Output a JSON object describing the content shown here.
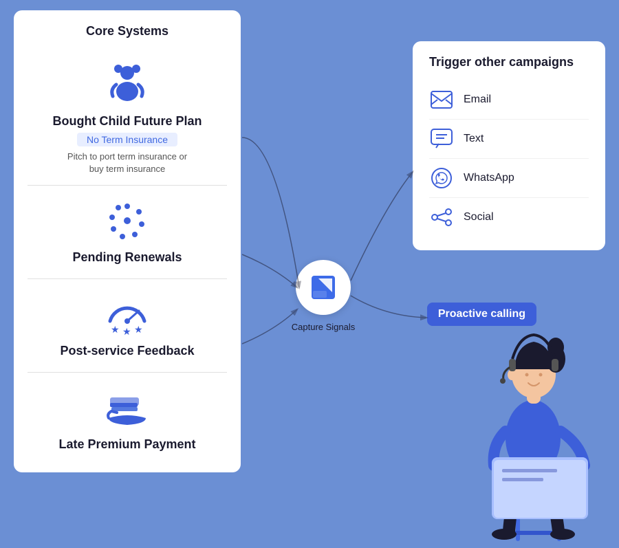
{
  "coreCard": {
    "title": "Core Systems",
    "items": [
      {
        "icon": "child",
        "title": "Bought Child Future Plan",
        "badge": "No Term Insurance",
        "desc": "Pitch to port term insurance or\nbuy term insurance"
      },
      {
        "icon": "renewals",
        "title": "Pending Renewals",
        "badge": null,
        "desc": null
      },
      {
        "icon": "feedback",
        "title": "Post-service Feedback",
        "badge": null,
        "desc": null
      },
      {
        "icon": "payment",
        "title": "Late Premium Payment",
        "badge": null,
        "desc": null
      }
    ]
  },
  "triggerCard": {
    "title": "Trigger other campaigns",
    "channels": [
      {
        "icon": "email",
        "label": "Email"
      },
      {
        "icon": "text",
        "label": "Text"
      },
      {
        "icon": "whatsapp",
        "label": "WhatsApp"
      },
      {
        "icon": "social",
        "label": "Social"
      }
    ]
  },
  "hub": {
    "label": "Capture Signals"
  },
  "proactiveBadge": {
    "label": "Proactive calling"
  }
}
